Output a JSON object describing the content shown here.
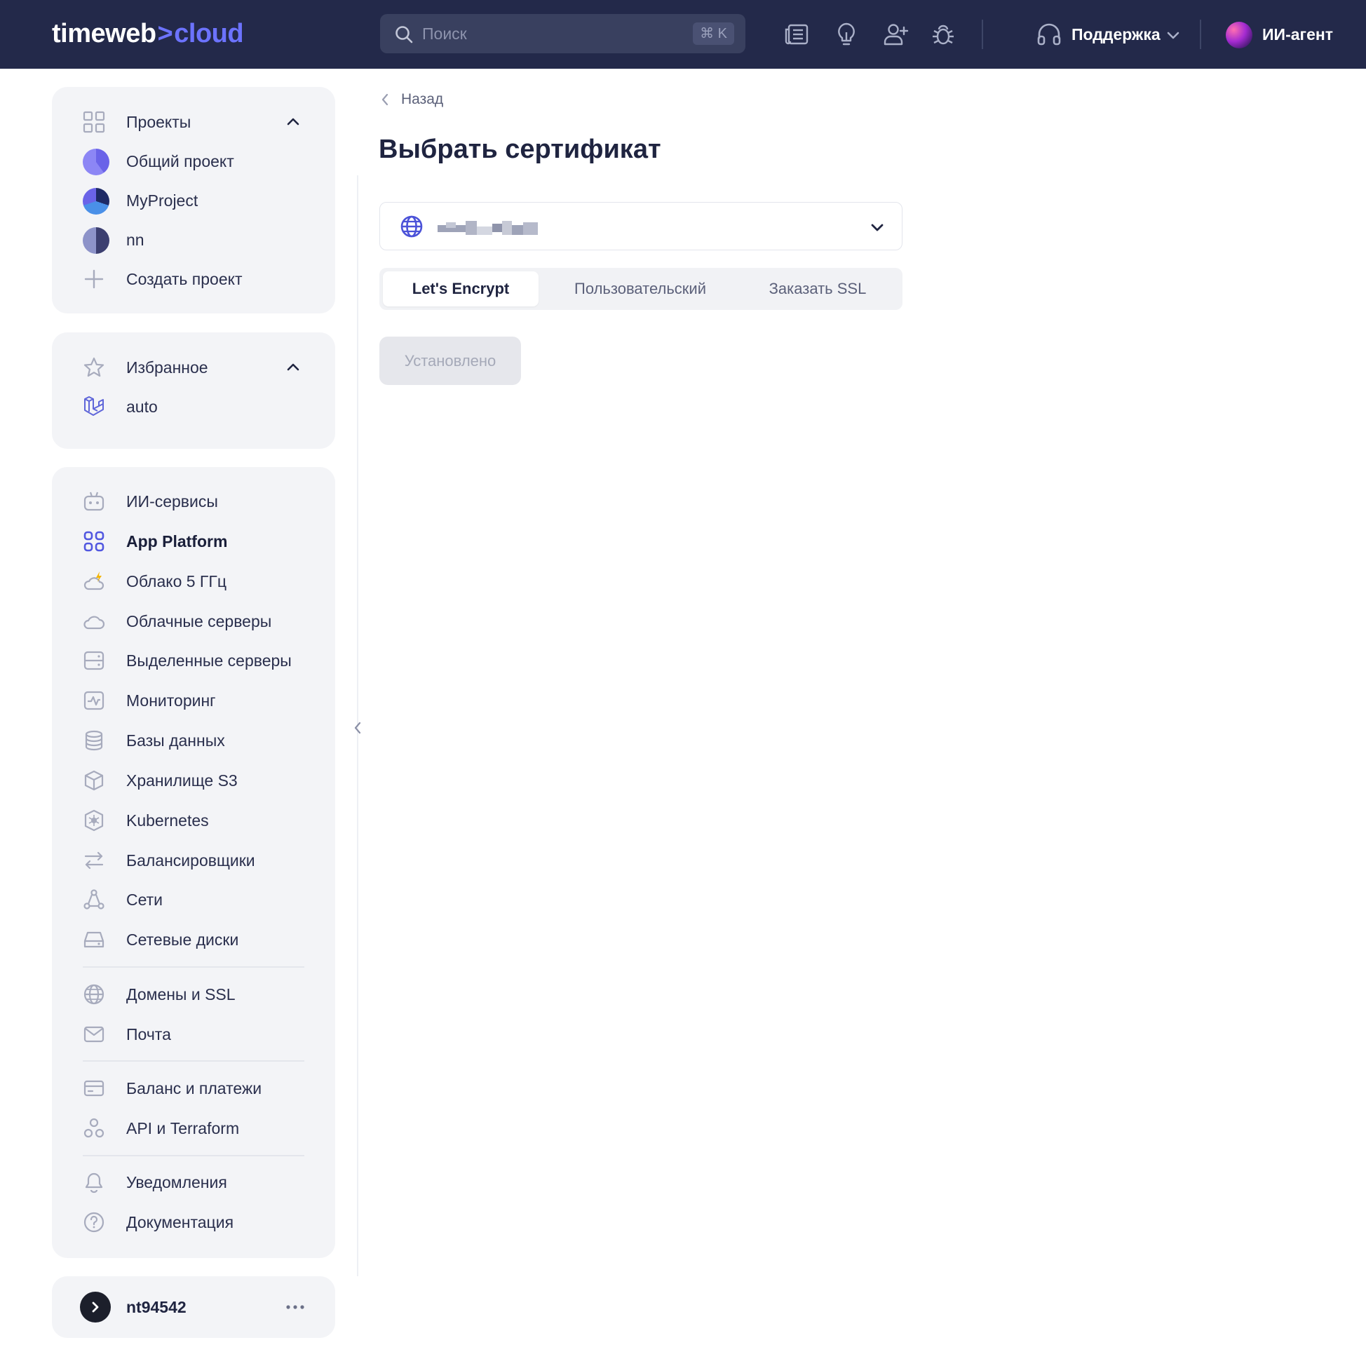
{
  "brand": {
    "part1": "timeweb",
    "separator": ">",
    "part2": "cloud",
    "accent_color": "#6c73ff",
    "header_bg": "#23294a"
  },
  "search": {
    "placeholder": "Поиск",
    "shortcut": "⌘ K"
  },
  "header_icons": [
    "news-icon",
    "idea-icon",
    "add-user-icon",
    "bug-icon"
  ],
  "support": {
    "label": "Поддержка"
  },
  "agent": {
    "label": "ИИ-агент"
  },
  "sidebar": {
    "projects": {
      "title": "Проекты",
      "items": [
        {
          "label": "Общий проект"
        },
        {
          "label": "MyProject"
        },
        {
          "label": "nn"
        }
      ],
      "create_label": "Создать проект"
    },
    "favorites": {
      "title": "Избранное",
      "items": [
        {
          "label": "auto"
        }
      ]
    },
    "services": [
      {
        "label": "ИИ-сервисы",
        "icon": "robot-icon"
      },
      {
        "label": "App Platform",
        "icon": "apps-grid-icon",
        "active": true
      },
      {
        "label": "Облако 5 ГГц",
        "icon": "cloud-bolt-icon"
      },
      {
        "label": "Облачные серверы",
        "icon": "cloud-icon"
      },
      {
        "label": "Выделенные серверы",
        "icon": "server-icon"
      },
      {
        "label": "Мониторинг",
        "icon": "monitoring-icon"
      },
      {
        "label": "Базы данных",
        "icon": "database-icon"
      },
      {
        "label": "Хранилище S3",
        "icon": "cube-icon"
      },
      {
        "label": "Kubernetes",
        "icon": "kubernetes-icon"
      },
      {
        "label": "Балансировщики",
        "icon": "balancer-icon"
      },
      {
        "label": "Сети",
        "icon": "network-icon"
      },
      {
        "label": "Сетевые диски",
        "icon": "disk-icon"
      },
      {
        "label": "Домены и SSL",
        "icon": "globe-icon"
      },
      {
        "label": "Почта",
        "icon": "mail-icon"
      },
      {
        "label": "Баланс и платежи",
        "icon": "card-icon"
      },
      {
        "label": "API и Terraform",
        "icon": "api-icon"
      },
      {
        "label": "Уведомления",
        "icon": "bell-icon"
      },
      {
        "label": "Документация",
        "icon": "help-icon"
      }
    ],
    "user": {
      "name": "nt94542"
    }
  },
  "main": {
    "back_label": "Назад",
    "title": "Выбрать сертификат",
    "tabs": [
      {
        "label": "Let's Encrypt",
        "active": true
      },
      {
        "label": "Пользовательский"
      },
      {
        "label": "Заказать SSL"
      }
    ],
    "installed_label": "Установлено"
  }
}
